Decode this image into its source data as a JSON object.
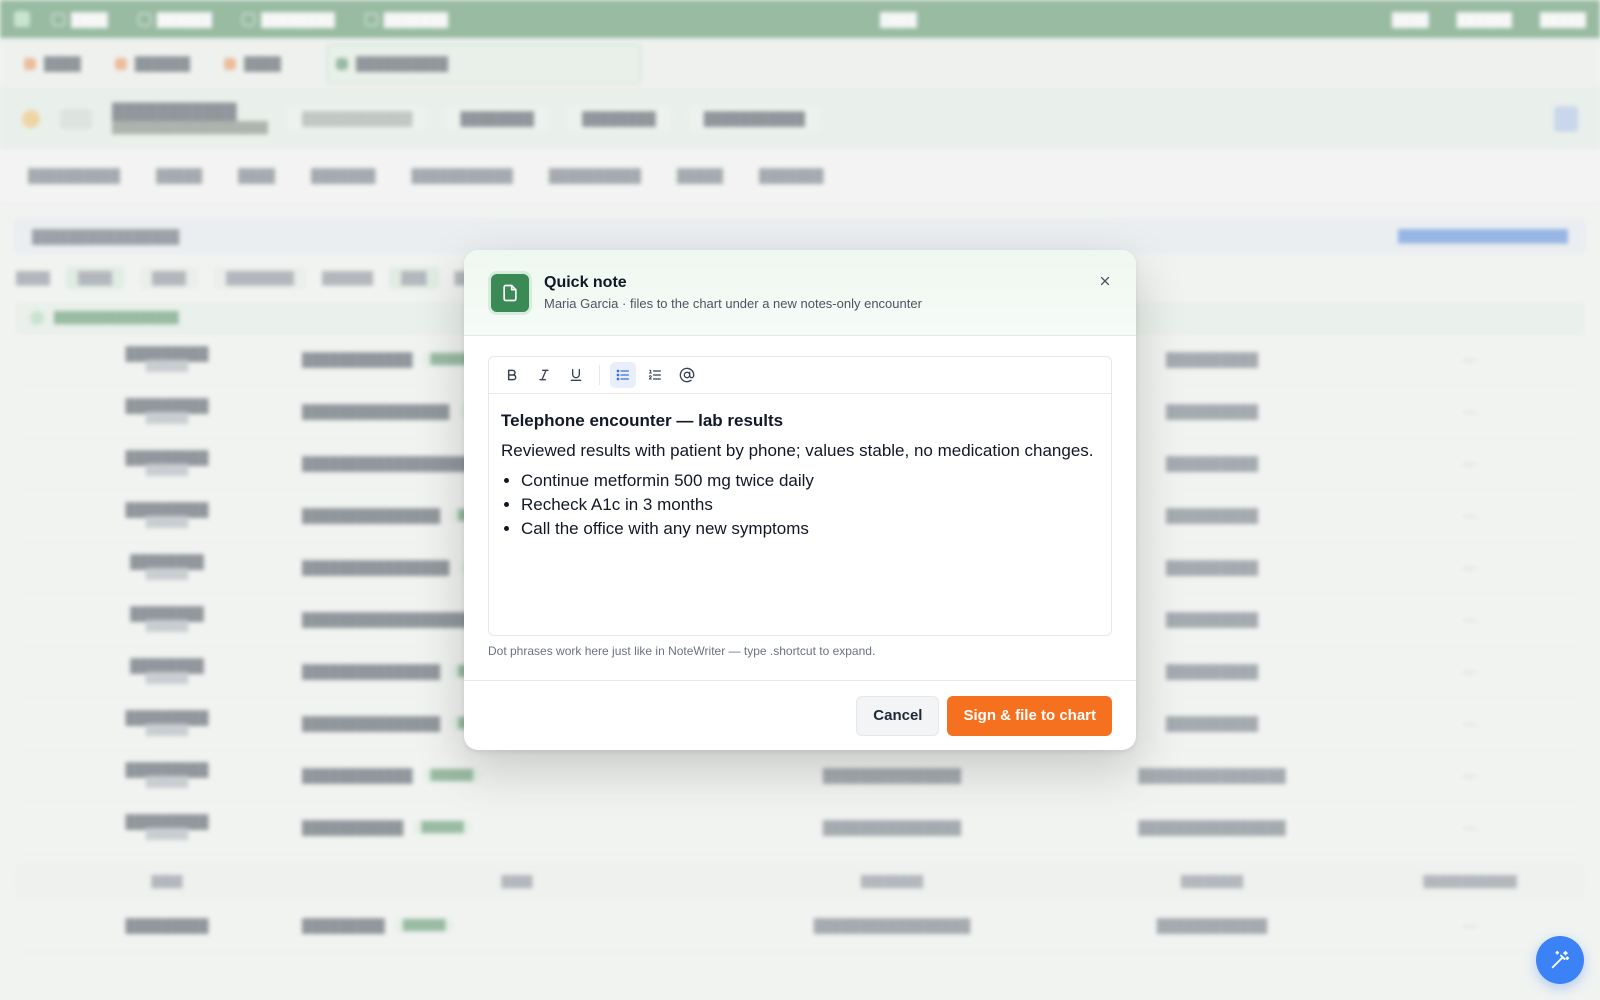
{
  "modal": {
    "title": "Quick note",
    "subtitle": "Maria Garcia · files to the chart under a new notes-only encounter",
    "toolbar": {
      "bold": "bold-icon",
      "italic": "italic-icon",
      "underline": "underline-icon",
      "bulleted_list": "bullet-list-icon",
      "numbered_list": "numbered-list-icon",
      "mention": "at-sign-icon",
      "active": "bulleted_list"
    },
    "note": {
      "heading": "Telephone encounter — lab results",
      "paragraph": "Reviewed results with patient by phone; values stable, no medication changes.",
      "bullets": [
        "Continue metformin 500 mg twice daily",
        "Recheck A1c in 3 months",
        "Call the office with any new symptoms"
      ]
    },
    "hint": "Dot phrases work here just like in NoteWriter — type .shortcut to expand.",
    "cancel_label": "Cancel",
    "submit_label": "Sign & file to chart"
  },
  "colors": {
    "brand_green": "#3a8a55",
    "primary_orange": "#f5701f",
    "fab_blue": "#3b82f6"
  }
}
